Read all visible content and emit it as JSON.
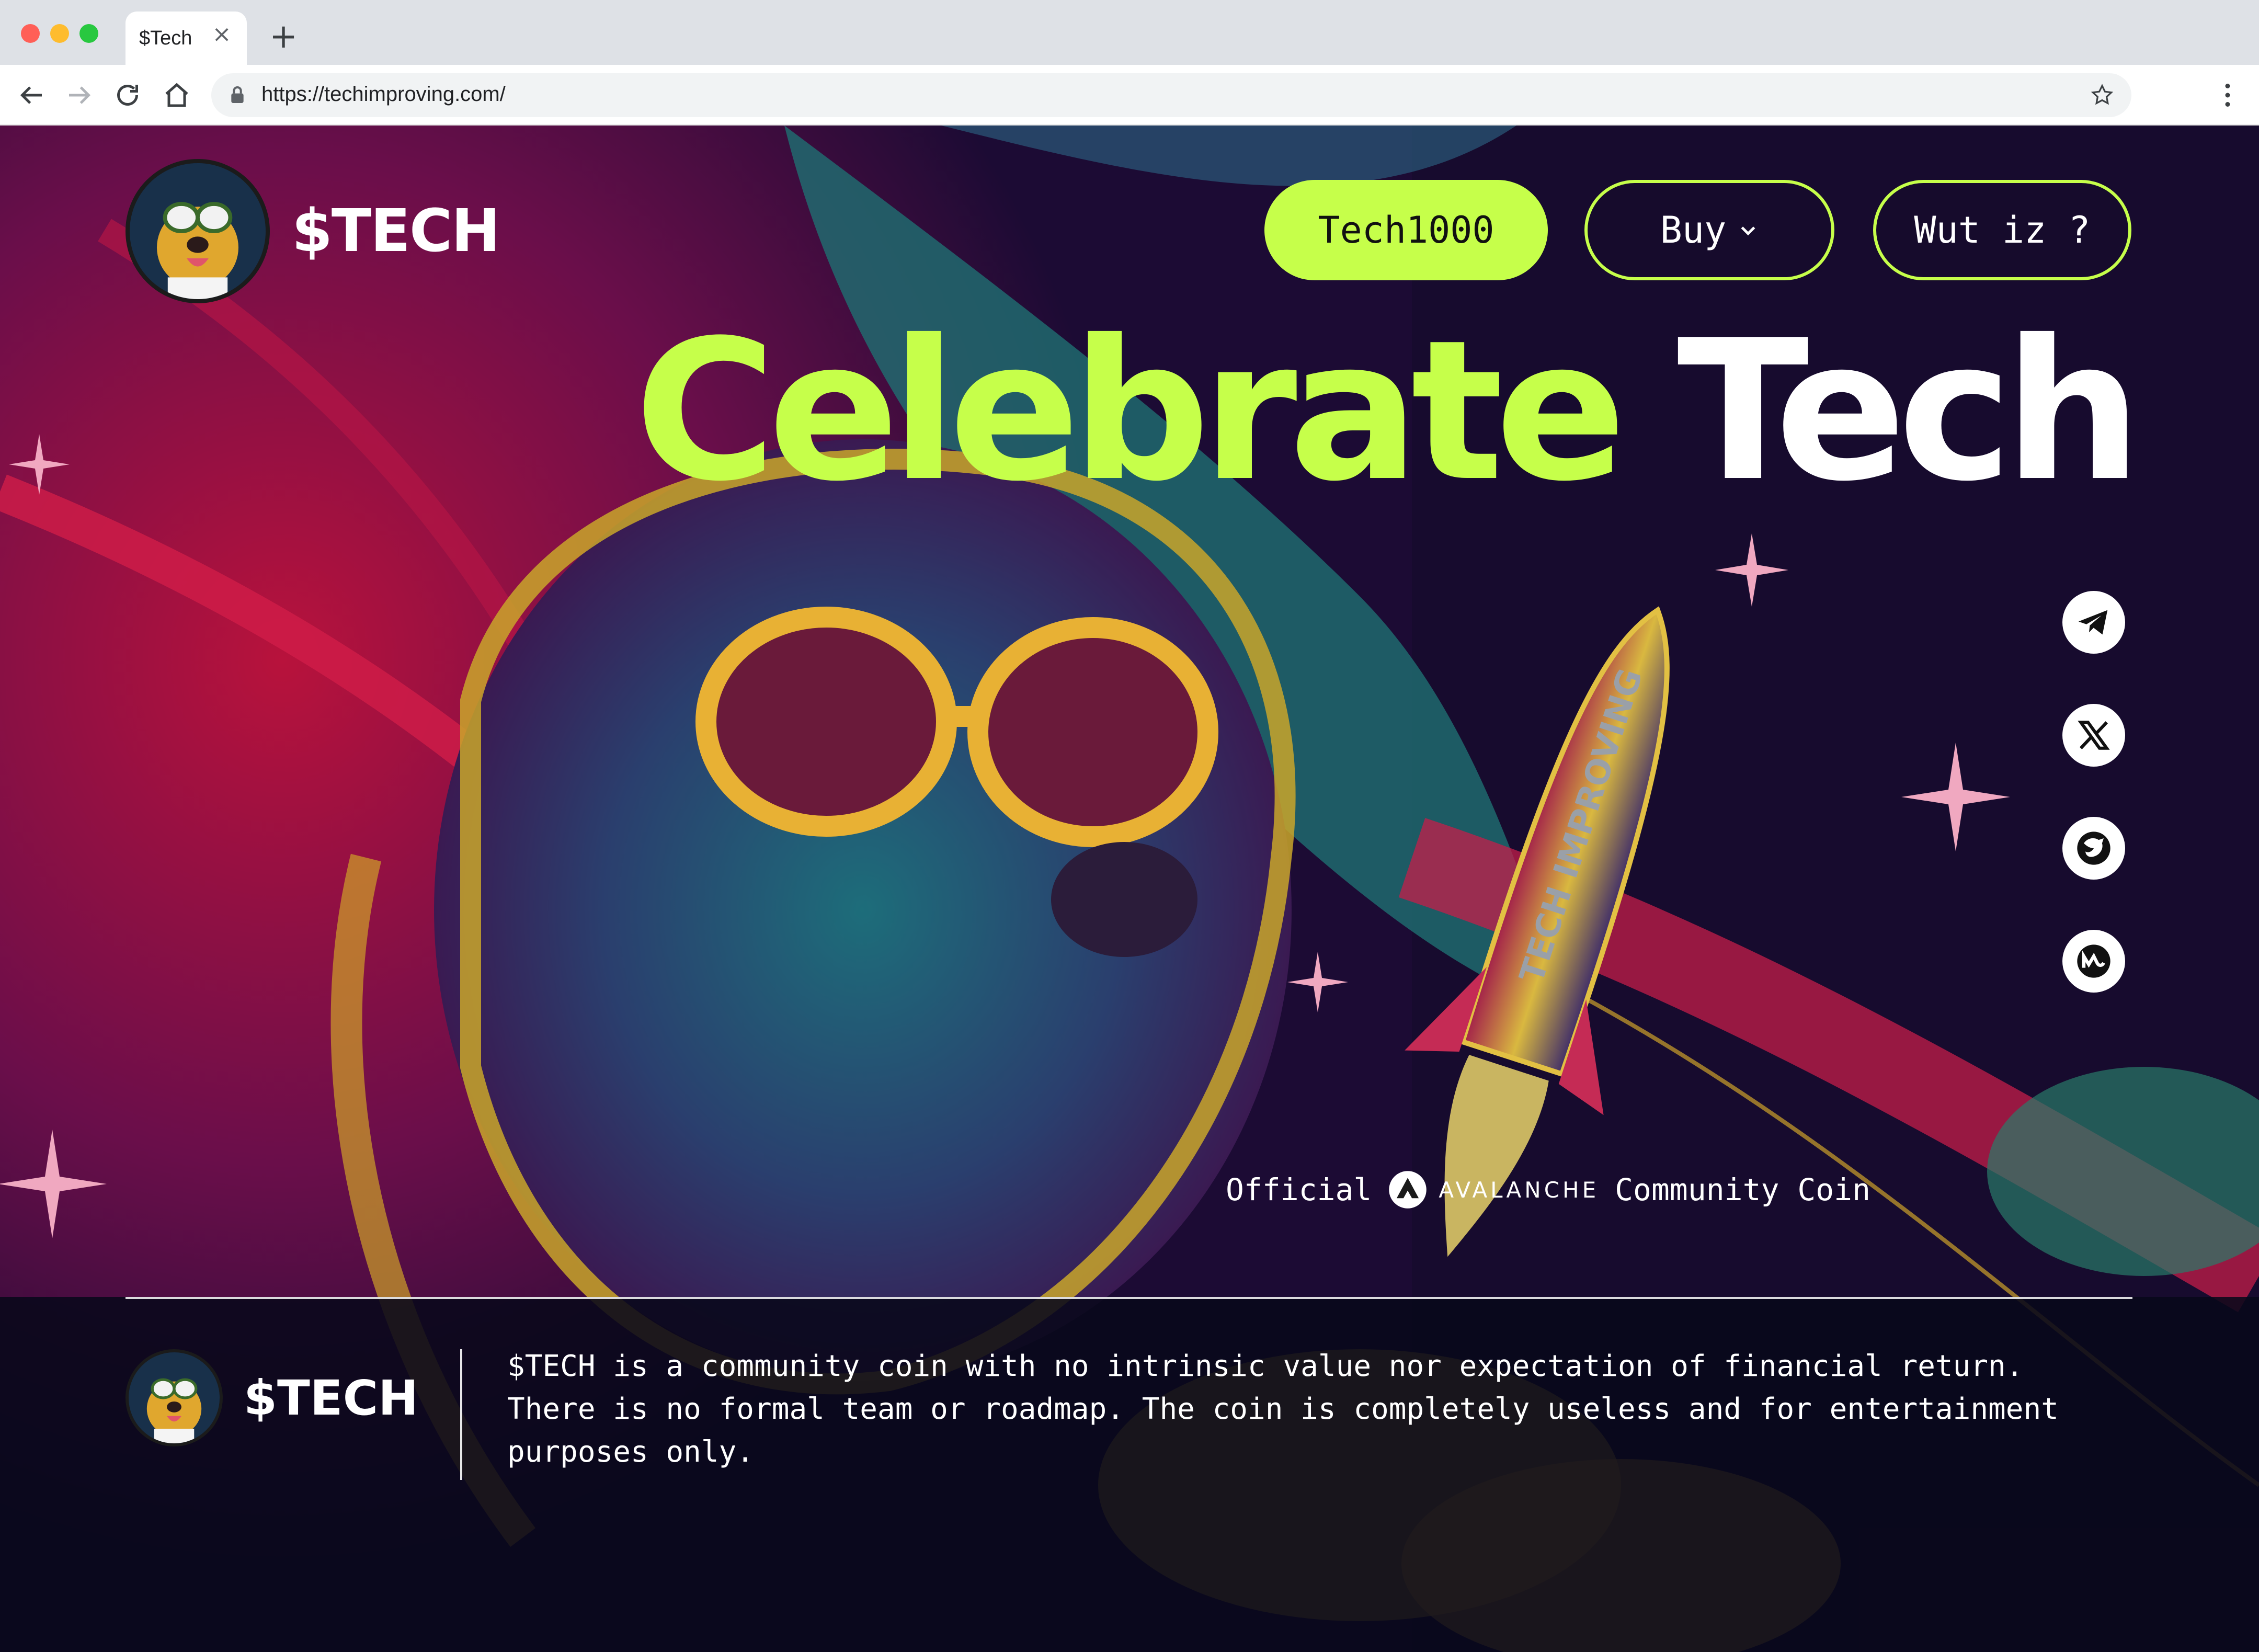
{
  "browser": {
    "tab_title": "$Tech",
    "url": "https://techimproving.com/"
  },
  "page": {
    "brand": "$TECH",
    "nav": {
      "primary_label": "Tech1000",
      "buy_label": "Buy",
      "wut_label": "Wut iz ?"
    },
    "headline": {
      "part1": "Celebrate",
      "part2": "Tech"
    },
    "rocket_text": "TECH IMPROVING",
    "official": {
      "prefix": "Official",
      "network": "AVALANCHE",
      "suffix": "Community Coin"
    },
    "socials": [
      "telegram-icon",
      "x-icon",
      "dexscreener-icon",
      "coinmarketcap-icon"
    ],
    "footer": {
      "brand": "$TECH",
      "disclaimer": "$TECH is a community coin with no intrinsic value nor expectation of financial return. There is no formal team or roadmap. The coin is completely useless and for entertainment purposes only."
    },
    "colors": {
      "accent": "#c6ff4a",
      "background": "#160c2c",
      "text": "#ffffff"
    }
  }
}
